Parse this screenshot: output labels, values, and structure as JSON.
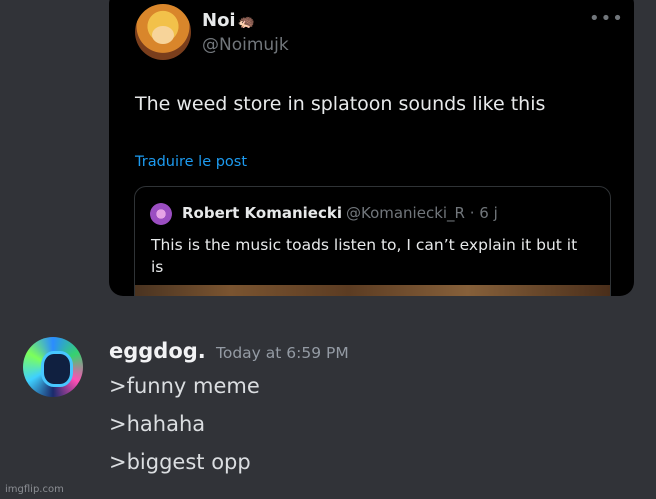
{
  "tweet": {
    "author_name": "Noi",
    "author_emoji": "🦔",
    "author_handle": "@Noimujk",
    "more_icon": "more-horizontal-icon",
    "text": "The weed store in splatoon sounds like this",
    "translate_link": "Traduire le post",
    "quote": {
      "author_name": "Robert Komaniecki",
      "author_handle": "@Komaniecki_R · 6 j",
      "text": "This is the music toads listen to, I can’t explain it but it is"
    }
  },
  "message": {
    "username": "eggdog.",
    "timestamp": "Today at 6:59 PM",
    "lines": [
      ">funny meme",
      ">hahaha",
      ">biggest opp"
    ]
  },
  "watermark": "imgflip.com",
  "colors": {
    "background": "#313338",
    "tweet_background": "#000000",
    "link_blue": "#1d9bf0"
  }
}
